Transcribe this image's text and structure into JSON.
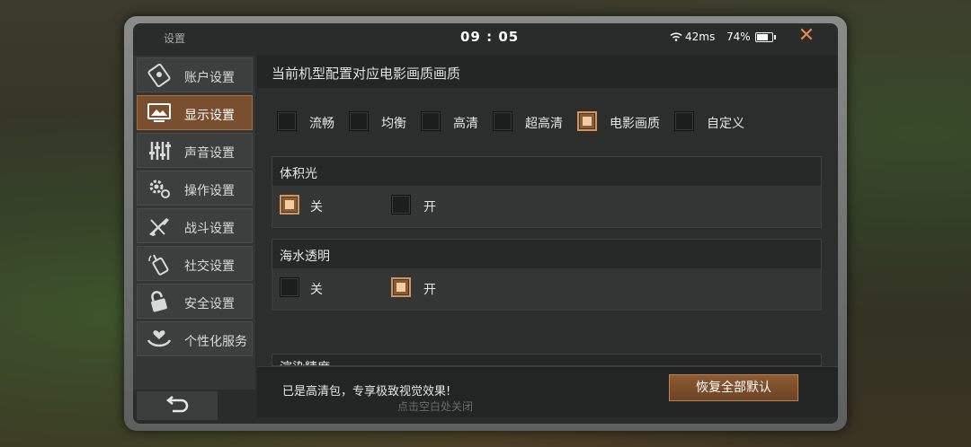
{
  "topbar": {
    "title": "设置",
    "time": "09 : 05",
    "ping": "42ms",
    "battery": "74%",
    "battery_level": 0.74,
    "wifi_icon": "wifi-icon",
    "close_icon": "close-icon"
  },
  "sidebar": {
    "items": [
      {
        "label": "账户设置",
        "icon": "account-card-icon",
        "active": false
      },
      {
        "label": "显示设置",
        "icon": "display-picture-icon",
        "active": true
      },
      {
        "label": "声音设置",
        "icon": "sound-sliders-icon",
        "active": false
      },
      {
        "label": "操作设置",
        "icon": "control-gear-icon",
        "active": false
      },
      {
        "label": "战斗设置",
        "icon": "rifle-icon",
        "active": false
      },
      {
        "label": "社交设置",
        "icon": "walkie-talkie-icon",
        "active": false
      },
      {
        "label": "安全设置",
        "icon": "lock-icon",
        "active": false
      },
      {
        "label": "个性化服务",
        "icon": "heart-hands-icon",
        "active": false
      }
    ]
  },
  "main": {
    "header": "当前机型配置对应电影画质画质",
    "quality_options": [
      {
        "label": "流畅",
        "checked": false
      },
      {
        "label": "均衡",
        "checked": false
      },
      {
        "label": "高清",
        "checked": false
      },
      {
        "label": "超高清",
        "checked": false
      },
      {
        "label": "电影画质",
        "checked": true
      },
      {
        "label": "自定义",
        "checked": false
      }
    ],
    "sections": [
      {
        "title": "体积光",
        "off_label": "关",
        "on_label": "开",
        "value": "关"
      },
      {
        "title": "海水透明",
        "off_label": "关",
        "on_label": "开",
        "value": "开"
      }
    ],
    "partial_section_title": "渲染精度"
  },
  "footer": {
    "message": "已是高清包，专享极致视觉效果!",
    "reset_button": "恢复全部默认"
  },
  "bottom": {
    "back_icon": "back-arrow-icon",
    "hint": "点击空白处关闭"
  },
  "colors": {
    "accent": "#d69356",
    "active_tab": "#7a4f30",
    "close": "#e8874a"
  }
}
